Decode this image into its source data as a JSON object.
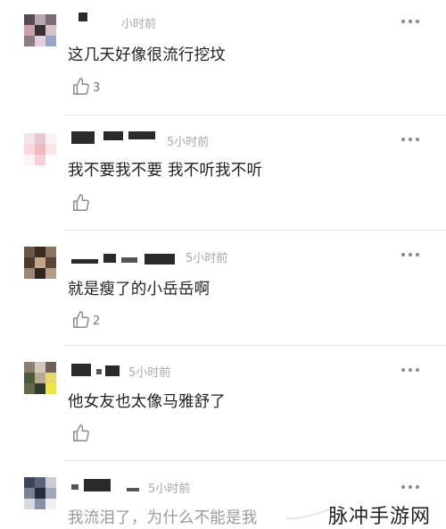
{
  "comments": [
    {
      "time": "小时前",
      "text": "这几天好像很流行挖坟",
      "likes": "3"
    },
    {
      "time": "5小时前",
      "text": "我不要我不要 我不听我不听",
      "likes": ""
    },
    {
      "time": "5小时前",
      "text": "就是瘦了的小岳岳啊",
      "likes": "2"
    },
    {
      "time": "5小时前",
      "text": "他女友也太像马雅舒了",
      "likes": ""
    },
    {
      "time": "5小时前",
      "text": "我流泪了，为什么不能是我",
      "likes": ""
    }
  ],
  "icons": {
    "like": "thumbs-up-icon",
    "more": "more-dots-icon"
  },
  "watermark": "脉冲手游网",
  "colors": {
    "text": "#222222",
    "time": "#a9a9a9",
    "divider": "#e6e6e6",
    "icon": "#8a8a8a"
  }
}
